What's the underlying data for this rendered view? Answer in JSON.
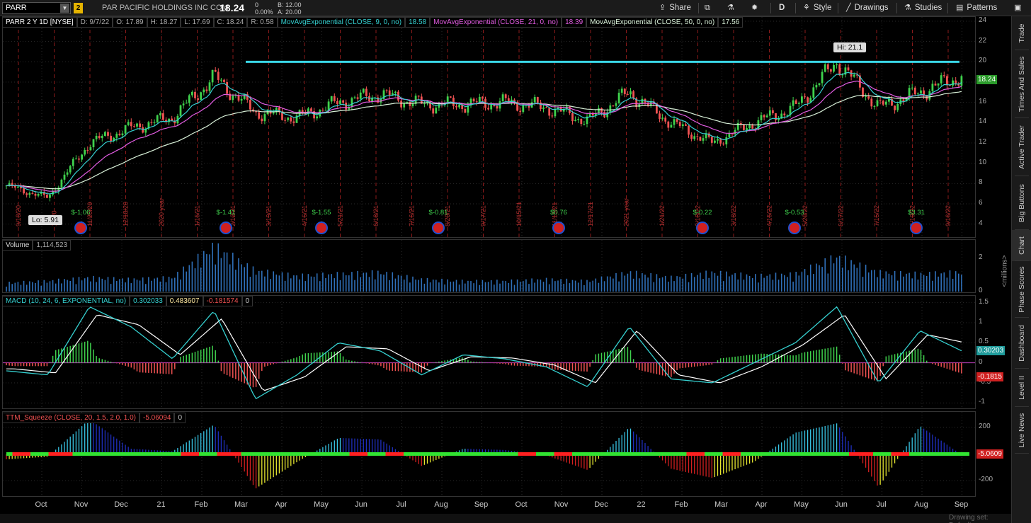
{
  "header": {
    "symbol": "PARR",
    "link_badge": "2",
    "company": "PAR PACIFIC HOLDINGS INC COM",
    "last": "18.24",
    "change": "0",
    "change_pct": "0.00%",
    "bid": "B: 12.00",
    "ask": "A: 20.00",
    "buttons": {
      "share": "Share",
      "timeframe": "D",
      "style": "Style",
      "drawings": "Drawings",
      "studies": "Studies",
      "patterns": "Patterns"
    }
  },
  "sidebar_tabs": [
    "Trade",
    "Times And Sales",
    "Active Trader",
    "Big Buttons",
    "Chart",
    "Phase Scores",
    "Dashboard",
    "Level II",
    "Live News"
  ],
  "price_info": {
    "symbol_line": "PARR 2 Y 1D [NYSE]",
    "date": "D: 9/7/22",
    "open": "O: 17.89",
    "high": "H: 18.27",
    "low": "L: 17.69",
    "close": "C: 18.24",
    "range": "R: 0.58",
    "ema9_label": "MovAvgExponential (CLOSE, 9, 0, no)",
    "ema9_val": "18.58",
    "ema21_label": "MovAvgExponential (CLOSE, 21, 0, no)",
    "ema21_val": "18.39",
    "ema50_label": "MovAvgExponential (CLOSE, 50, 0, no)",
    "ema50_val": "17.56"
  },
  "volume_info": {
    "label": "Volume",
    "value": "1,114,523",
    "axis_unit": "<millions>"
  },
  "macd_info": {
    "label": "MACD (10, 24, 6, EXPONENTIAL, no)",
    "value": "0.302033",
    "avg": "0.483607",
    "diff": "-0.181574",
    "zero": "0"
  },
  "ttm_info": {
    "label": "TTM_Squeeze (CLOSE, 20, 1.5, 2.0, 1.0)",
    "value": "-5.06094",
    "zero": "0"
  },
  "annotations": {
    "high": "Hi: 21.1",
    "low": "Lo: 5.91",
    "earnings": [
      "$-1.06",
      "$-1.41",
      "$-1.55",
      "$-0.81",
      "$0.76",
      "$-0.22",
      "$-0.53",
      "$3.31"
    ],
    "event_dates": [
      "9/18/20",
      "10/20",
      "11/20/20",
      "12/18/20",
      "2020 year",
      "1/15/21",
      "2/12/21",
      "3/19/21",
      "4/16/21",
      "5/21/21",
      "6/18/21",
      "7/16/21",
      "8/20/21",
      "9/17/21",
      "10/15/21",
      "11/19/21",
      "12/17/21",
      "2021 year",
      "1/21/22",
      "2/18/22",
      "3/18/22",
      "4/15/22",
      "5/20/22",
      "6/17/22",
      "7/15/22",
      "8/19/22",
      "9/16/22"
    ]
  },
  "tags": {
    "price": "18.24",
    "macd_value": "0.30203",
    "macd_diff": "-0.1815",
    "ttm_value": "-5.0609"
  },
  "bottom": {
    "drawing_set": "Drawing set: Default"
  },
  "colors": {
    "candle_up": "#3fd24d",
    "candle_down": "#f05252",
    "ema9": "#35d0d0",
    "ema21": "#e25ce2",
    "ema50": "#d8f0d8",
    "resistance": "#3ad6e6",
    "volume": "#2f6fb8",
    "macd": "#35d0d0",
    "macd_avg": "#ffffff",
    "squeeze_on": "#ff2020",
    "squeeze_off": "#31e331"
  },
  "chart_data": [
    {
      "type": "candlestick",
      "title": "PARR 2 Y 1D [NYSE]",
      "x": [
        "Oct",
        "Nov",
        "Dec",
        "21",
        "Feb",
        "Mar",
        "Apr",
        "May",
        "Jun",
        "Jul",
        "Aug",
        "Sep",
        "Oct",
        "Nov",
        "Dec",
        "22",
        "Feb",
        "Mar",
        "Apr",
        "May",
        "Jun",
        "Jul",
        "Aug",
        "Sep"
      ],
      "ylim": [
        3,
        24
      ],
      "yticks": [
        4,
        6,
        8,
        10,
        12,
        14,
        16,
        18,
        20,
        22,
        24
      ],
      "close": [
        7.8,
        6.6,
        12.0,
        13.5,
        14.5,
        18.5,
        15.0,
        14.5,
        16.0,
        16.8,
        15.8,
        15.8,
        16.0,
        15.5,
        14.2,
        17.0,
        14.0,
        12.0,
        14.0,
        15.5,
        20.0,
        15.5,
        17.0,
        18.6
      ],
      "resistance": 20.0,
      "high_mark": 21.1,
      "low_mark": 5.91,
      "last": 18.24
    },
    {
      "type": "bar",
      "title": "Volume",
      "ylim": [
        0,
        3
      ],
      "yticks": [
        0,
        2
      ],
      "unit": "millions",
      "x": [
        "Oct",
        "Nov",
        "Dec",
        "21",
        "Feb",
        "Mar",
        "Apr",
        "May",
        "Jun",
        "Jul",
        "Aug",
        "Sep",
        "Oct",
        "Nov",
        "Dec",
        "22",
        "Feb",
        "Mar",
        "Apr",
        "May",
        "Jun",
        "Jul",
        "Aug",
        "Sep"
      ],
      "values": [
        0.5,
        0.6,
        0.8,
        0.7,
        0.8,
        2.6,
        1.2,
        0.9,
        1.0,
        1.1,
        0.7,
        0.6,
        0.6,
        0.7,
        0.6,
        1.1,
        0.8,
        1.1,
        0.9,
        1.0,
        2.0,
        1.1,
        1.0,
        1.1
      ]
    },
    {
      "type": "line",
      "title": "MACD (10, 24, 6, EXPONENTIAL, no)",
      "ylim": [
        -1.1,
        1.6
      ],
      "yticks": [
        -1,
        -0.5,
        0,
        0.5,
        1,
        1.5
      ],
      "x": [
        "Oct",
        "Nov",
        "Dec",
        "21",
        "Feb",
        "Mar",
        "Apr",
        "May",
        "Jun",
        "Jul",
        "Aug",
        "Sep",
        "Oct",
        "Nov",
        "Dec",
        "22",
        "Feb",
        "Mar",
        "Apr",
        "May",
        "Jun",
        "Jul",
        "Aug",
        "Sep"
      ],
      "series": [
        {
          "name": "MACD",
          "values": [
            -0.2,
            -0.3,
            1.4,
            0.9,
            0.1,
            1.3,
            -0.9,
            -0.3,
            0.5,
            0.3,
            -0.3,
            0.2,
            0.1,
            -0.1,
            -0.6,
            0.9,
            -0.4,
            -0.5,
            0.0,
            0.5,
            1.4,
            -0.5,
            0.8,
            0.3
          ]
        },
        {
          "name": "Avg",
          "values": [
            -0.15,
            -0.25,
            1.2,
            0.95,
            0.2,
            1.1,
            -0.7,
            -0.35,
            0.4,
            0.35,
            -0.2,
            0.15,
            0.12,
            -0.05,
            -0.5,
            0.8,
            -0.3,
            -0.5,
            -0.1,
            0.45,
            1.2,
            -0.4,
            0.7,
            0.48
          ]
        }
      ]
    },
    {
      "type": "bar",
      "title": "TTM_Squeeze (CLOSE, 20, 1.5, 2.0, 1.0)",
      "ylim": [
        -300,
        300
      ],
      "yticks": [
        -200,
        200
      ],
      "x": [
        "Oct",
        "Nov",
        "Dec",
        "21",
        "Feb",
        "Mar",
        "Apr",
        "May",
        "Jun",
        "Jul",
        "Aug",
        "Sep",
        "Oct",
        "Nov",
        "Dec",
        "22",
        "Feb",
        "Mar",
        "Apr",
        "May",
        "Jun",
        "Jul",
        "Aug",
        "Sep"
      ],
      "values": [
        -40,
        -20,
        260,
        40,
        20,
        220,
        -260,
        -60,
        120,
        110,
        -90,
        40,
        30,
        -10,
        -120,
        200,
        -110,
        -180,
        -60,
        160,
        230,
        -250,
        210,
        -5
      ]
    }
  ]
}
